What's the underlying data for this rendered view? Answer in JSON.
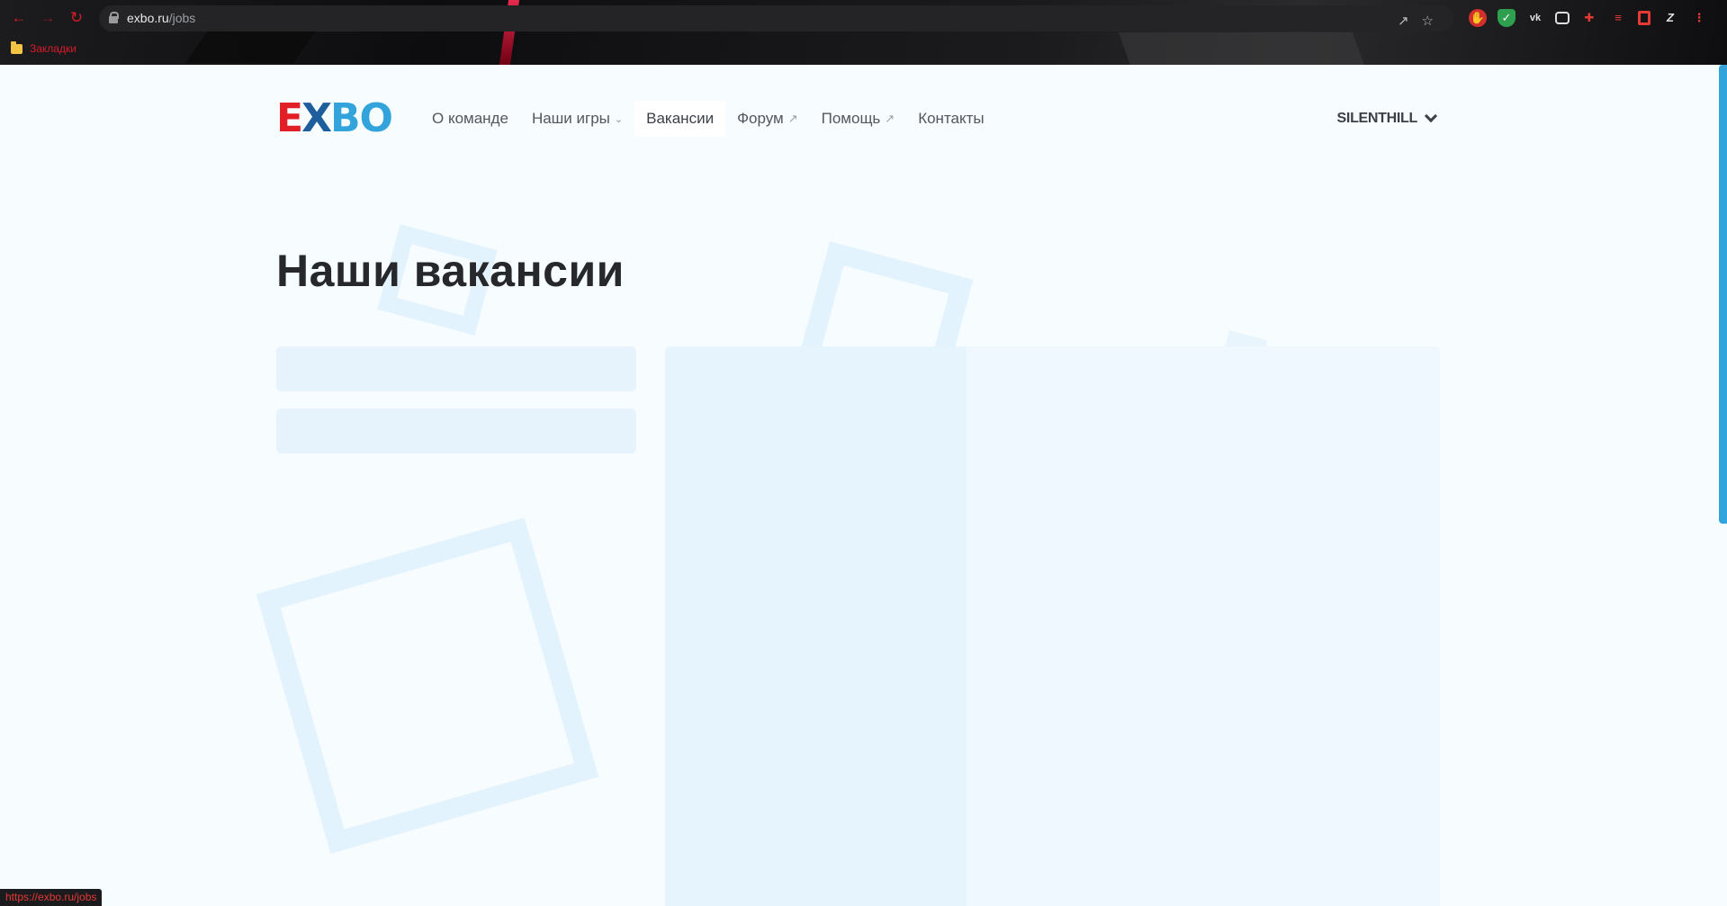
{
  "browser": {
    "url_host": "exbo.ru",
    "url_path": "/jobs",
    "bookmarks_label": "Закладки",
    "status_url": "https://exbo.ru/jobs"
  },
  "header": {
    "logo": {
      "e": "E",
      "x": "X",
      "bo": "BO"
    },
    "nav": [
      {
        "label": "О команде",
        "has_dropdown": false,
        "external": false,
        "active": false
      },
      {
        "label": "Наши игры",
        "has_dropdown": true,
        "external": false,
        "active": false
      },
      {
        "label": "Вакансии",
        "has_dropdown": false,
        "external": false,
        "active": true
      },
      {
        "label": "Форум",
        "has_dropdown": false,
        "external": true,
        "active": false
      },
      {
        "label": "Помощь",
        "has_dropdown": false,
        "external": true,
        "active": false
      },
      {
        "label": "Контакты",
        "has_dropdown": false,
        "external": false,
        "active": false
      }
    ],
    "user": "SILENTHILL"
  },
  "main": {
    "title": "Наши вакансии"
  },
  "colors": {
    "brand_red": "#e21f26",
    "brand_blue": "#33a3dc",
    "brand_dark_blue": "#1e5e9c",
    "page_bg": "#f7fcff",
    "skeleton": "#e6f3fd"
  },
  "icons": {
    "back": "arrow-left-icon",
    "forward": "arrow-right-icon",
    "reload": "reload-icon",
    "lock": "lock-icon",
    "share": "share-icon",
    "bookmark": "star-icon"
  }
}
